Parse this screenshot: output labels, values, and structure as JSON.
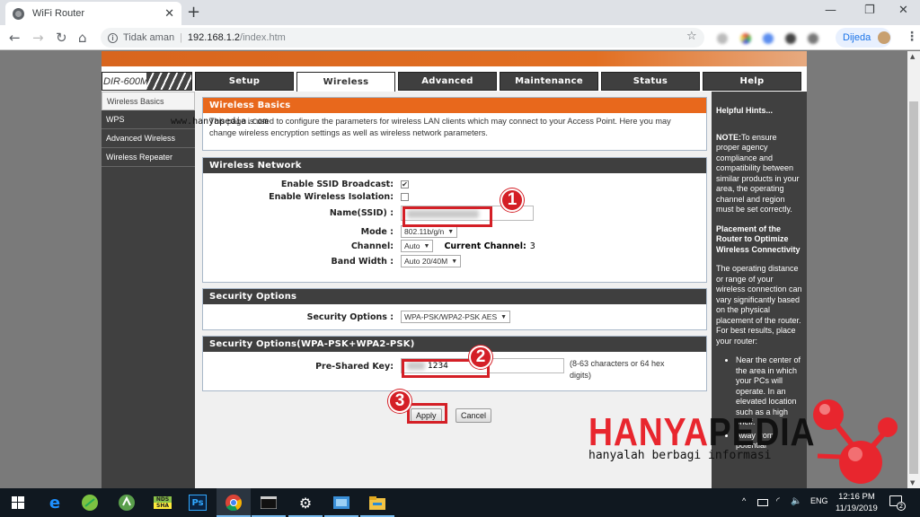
{
  "browser": {
    "tab_title": "WiFi Router",
    "tab_close": "✕",
    "new_tab": "+",
    "window_controls": {
      "minimize": "—",
      "restore": "❐",
      "close": "✕"
    },
    "nav": {
      "back": "←",
      "forward": "→",
      "reload": "↻",
      "home": "⌂"
    },
    "address": {
      "security_label": "Tidak aman",
      "separator": "|",
      "host": "192.168.1.2",
      "path": "/index.htm"
    },
    "bookmark_icon": "☆",
    "profile_name": "Dijeda",
    "menu": "⋮"
  },
  "router": {
    "model": "DIR-600M",
    "tabs": [
      {
        "label": "Setup",
        "active": false
      },
      {
        "label": "Wireless",
        "active": true
      },
      {
        "label": "Advanced",
        "active": false
      },
      {
        "label": "Maintenance",
        "active": false
      },
      {
        "label": "Status",
        "active": false
      },
      {
        "label": "Help",
        "active": false
      }
    ],
    "left_nav": [
      {
        "label": "Wireless Basics",
        "active": true
      },
      {
        "label": "WPS",
        "active": false
      },
      {
        "label": "Advanced Wireless",
        "active": false
      },
      {
        "label": "Wireless Repeater",
        "active": false
      }
    ],
    "basics": {
      "title": "Wireless Basics",
      "description": "This page is used to configure the parameters for wireless LAN clients which may connect to your Access Point. Here you may change wireless encryption settings as well as wireless network parameters."
    },
    "wireless_network": {
      "title": "Wireless Network",
      "ssid_broadcast_label": "Enable SSID Broadcast:",
      "ssid_broadcast_checked": "✔",
      "isolation_label": "Enable Wireless Isolation:",
      "name_label": "Name(SSID) :",
      "mode_label": "Mode :",
      "mode_value": "802.11b/g/n",
      "channel_label": "Channel:",
      "channel_value": "Auto",
      "current_channel_label": "Current Channel:",
      "current_channel_value": "3",
      "bandwidth_label": "Band Width :",
      "bandwidth_value": "Auto 20/40M",
      "dropdown_arrow": "▼"
    },
    "security": {
      "title": "Security Options",
      "label": "Security Options :",
      "value": "WPA-PSK/WPA2-PSK AES"
    },
    "wpa": {
      "title": "Security Options(WPA-PSK+WPA2-PSK)",
      "psk_label": "Pre-Shared Key:",
      "psk_value_visible": "1234",
      "hint": "(8-63 characters or 64 hex digits)"
    },
    "buttons": {
      "apply": "Apply",
      "cancel": "Cancel"
    },
    "hints": {
      "title": "Helpful Hints...",
      "note_bold": "NOTE:",
      "note_text": "To ensure proper agency compliance and compatibility between similar products in your area, the operating channel and region must be set correctly.",
      "placement_title": "Placement of the Router to Optimize Wireless Connectivity",
      "placement_text": "The operating distance or range of your wireless connection can vary significantly based on the physical placement of the router. For best results, place your router:",
      "bullets": [
        "Near the center of the area in which your PCs will operate. In an elevated location such as a high shelf.",
        "Away from potential"
      ]
    }
  },
  "annotations": {
    "step1": "1",
    "step2": "2",
    "step3": "3",
    "accent": "#d41f26"
  },
  "watermark": {
    "url": "www.hanyapedia.com",
    "logo_red": "HANYA",
    "logo_black": "PEDIA",
    "tagline": "hanyalah berbagi informasi"
  },
  "taskbar": {
    "apps": [
      "windows-start",
      "edge",
      "corel",
      "android-studio",
      "nds-sha",
      "photoshop",
      "chrome",
      "terminal",
      "settings",
      "remote",
      "file-explorer"
    ],
    "nds_label_top": "NDS",
    "nds_label_bottom": "SHA",
    "ps_label": "Ps",
    "tray_chevron": "^",
    "language": "ENG",
    "time": "12:16 PM",
    "date": "11/19/2019",
    "notifications": "2"
  },
  "colors": {
    "router_orange": "#e8681c",
    "router_dark": "#3f3f3f",
    "annotation_red": "#d41f26"
  }
}
